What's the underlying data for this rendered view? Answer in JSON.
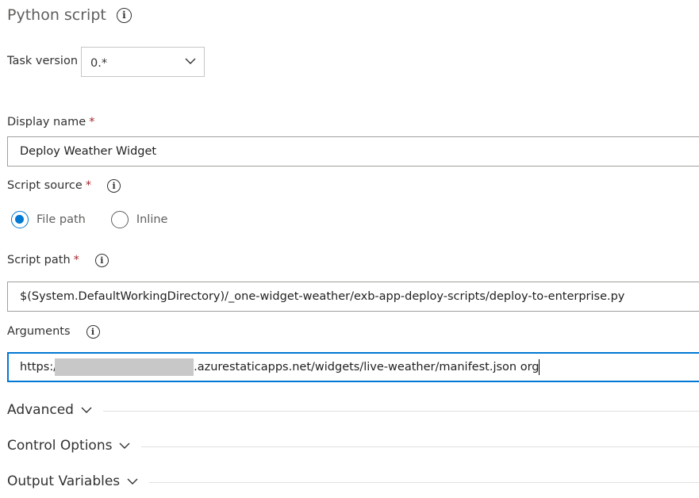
{
  "header": {
    "title": "Python script",
    "info_icon": "info-icon"
  },
  "task_version": {
    "label": "Task version",
    "value": "0.*",
    "icon": "chevron-down-icon"
  },
  "display_name": {
    "label": "Display name",
    "required_mark": "*",
    "value": "Deploy Weather Widget"
  },
  "script_source": {
    "label": "Script source",
    "required_mark": "*",
    "options": [
      {
        "label": "File path",
        "selected": true
      },
      {
        "label": "Inline",
        "selected": false
      }
    ]
  },
  "script_path": {
    "label": "Script path",
    "required_mark": "*",
    "value": "$(System.DefaultWorkingDirectory)/_one-widget-weather/exb-app-deploy-scripts/deploy-to-enterprise.py"
  },
  "arguments": {
    "label": "Arguments",
    "value_prefix": "https:/",
    "value_suffix": ".azurestaticapps.net/widgets/live-weather/manifest.json org"
  },
  "sections": [
    {
      "label": "Advanced",
      "icon": "chevron-down-icon"
    },
    {
      "label": "Control Options",
      "icon": "chevron-down-icon"
    },
    {
      "label": "Output Variables",
      "icon": "chevron-down-icon"
    }
  ],
  "colors": {
    "accent": "#0078d4",
    "required": "#a4262c"
  }
}
